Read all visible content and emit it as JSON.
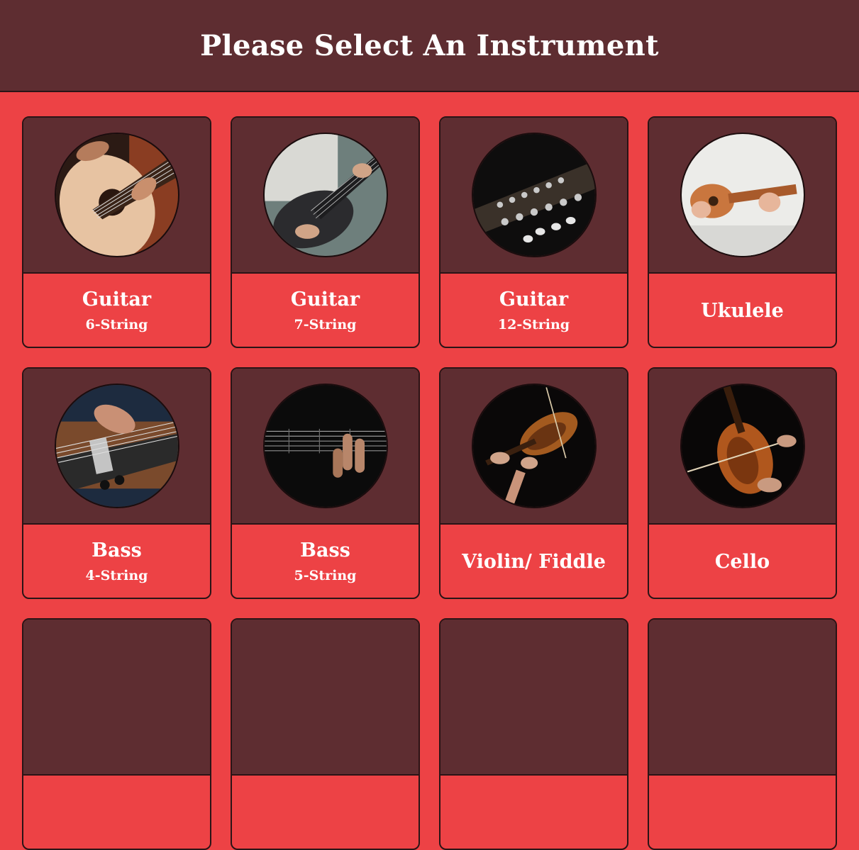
{
  "header": {
    "title": "Please Select An Instrument"
  },
  "instruments": [
    {
      "name": "Guitar",
      "sub": "6-String"
    },
    {
      "name": "Guitar",
      "sub": "7-String"
    },
    {
      "name": "Guitar",
      "sub": "12-String"
    },
    {
      "name": "Ukulele",
      "sub": ""
    },
    {
      "name": "Bass",
      "sub": "4-String"
    },
    {
      "name": "Bass",
      "sub": "5-String"
    },
    {
      "name": "Violin/ Fiddle",
      "sub": ""
    },
    {
      "name": "Cello",
      "sub": ""
    },
    {
      "name": "",
      "sub": ""
    },
    {
      "name": "",
      "sub": ""
    },
    {
      "name": "",
      "sub": ""
    },
    {
      "name": "",
      "sub": ""
    }
  ],
  "colors": {
    "page_background": "#ed4245",
    "header_background": "#5e2d31",
    "card_image_panel": "#5e2d31",
    "border": "#2a1416",
    "text": "#ffffff"
  }
}
